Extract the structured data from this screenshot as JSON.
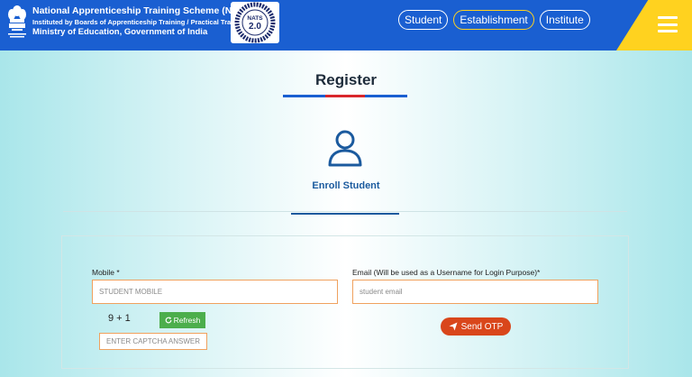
{
  "header": {
    "line1": "National Apprenticeship Training Scheme (NATS)",
    "line2": "Instituted by Boards of Apprenticeship Training / Practical Training",
    "line3": "Ministry of Education, Government of India",
    "logo_text": "NATS",
    "logo_version": "2.0"
  },
  "nav": {
    "items": [
      {
        "label": "Student"
      },
      {
        "label": "Establishment"
      },
      {
        "label": "Institute"
      }
    ]
  },
  "page": {
    "title": "Register",
    "enroll_label": "Enroll Student"
  },
  "form": {
    "mobile_label": "Mobile *",
    "mobile_placeholder": "STUDENT MOBILE",
    "email_label": "Email (Will be used as a Username for Login Purpose)*",
    "email_placeholder": "student email",
    "captcha_question": "9 + 1",
    "refresh_label": "Refresh",
    "captcha_placeholder": "ENTER CAPTCHA ANSWER",
    "send_otp_label": "Send OTP"
  },
  "colors": {
    "header_blue": "#1a5fd1",
    "accent_yellow": "#ffd21f",
    "title_red": "#d9262b",
    "refresh_green": "#4cae4c",
    "otp_orange": "#d9461b",
    "label_blue": "#1b5a9e"
  },
  "icons": [
    "emblem-icon",
    "nats-logo-icon",
    "menu-icon",
    "user-icon",
    "refresh-icon",
    "send-icon"
  ]
}
